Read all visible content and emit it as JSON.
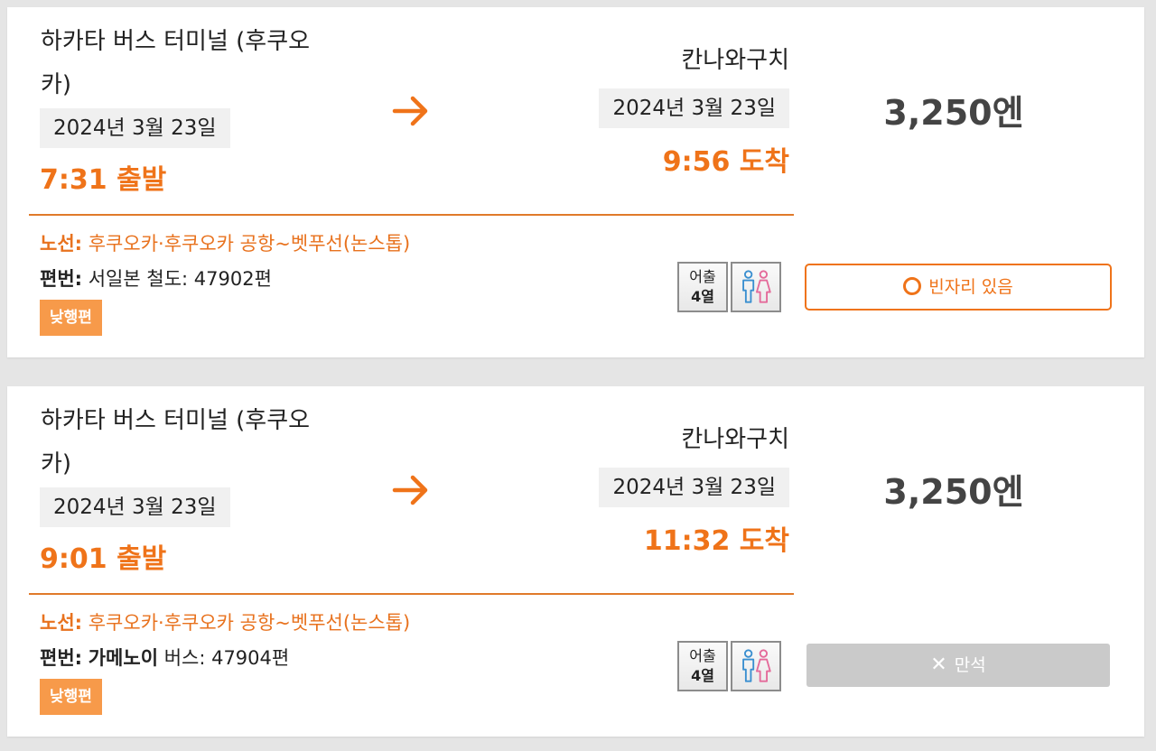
{
  "results": [
    {
      "origin": "하카타 버스 터미널 (후쿠오카)",
      "destination": "칸나와구치",
      "departure_date": "2024년 3월 23일",
      "arrival_date": "2024년 3월 23일",
      "departure_time": "7:31 출발",
      "arrival_time": "9:56 도착",
      "price": "3,250엔",
      "route_label": "노선:",
      "route_name": "후쿠오카·후쿠오카 공항~벳푸선(논스톱)",
      "service_label": "편번:",
      "service_operator": "서일본 철도",
      "service_number": ": 47902편",
      "tag": "낮행편",
      "seat_line1": "어출",
      "seat_line2": "4열",
      "status_label": "빈자리 있음",
      "status": "available"
    },
    {
      "origin": "하카타 버스 터미널 (후쿠오카)",
      "destination": "칸나와구치",
      "departure_date": "2024년 3월 23일",
      "arrival_date": "2024년 3월 23일",
      "departure_time": "9:01 출발",
      "arrival_time": "11:32 도착",
      "price": "3,250엔",
      "route_label": "노선:",
      "route_name": "후쿠오카·후쿠오카 공항~벳푸선(논스톱)",
      "service_label": "편번:",
      "service_operator": "가메노이",
      "service_number": " 버스: 47904편",
      "tag": "낮행편",
      "seat_line1": "어출",
      "seat_line2": "4열",
      "status_label": "만석",
      "status": "full"
    }
  ],
  "icons": {
    "arrow": "arrow-right-icon",
    "restroom": "restroom-icon",
    "available": "circle-icon",
    "full": "x-icon"
  },
  "colors": {
    "accent": "#ef7319",
    "tag_bg": "#f79a4a",
    "full_button": "#cacaca",
    "price": "#444444"
  }
}
